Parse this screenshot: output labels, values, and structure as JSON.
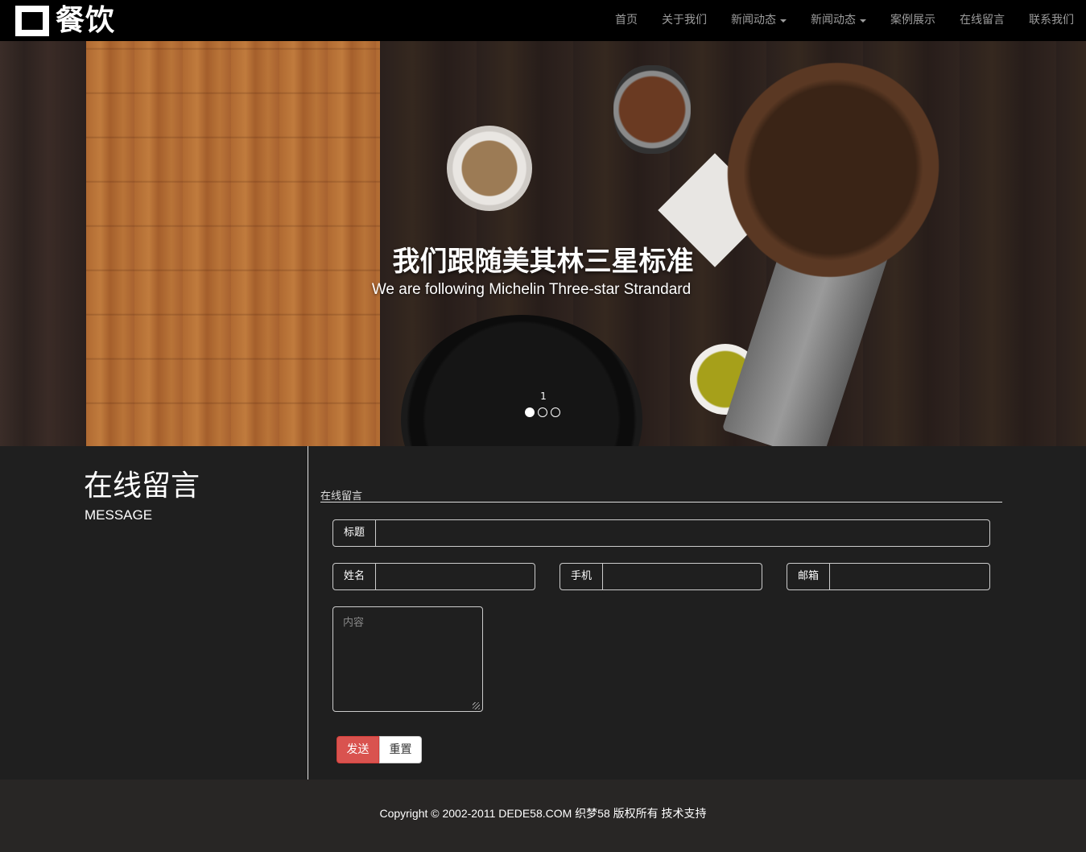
{
  "brand": {
    "logo_text": "餐饮"
  },
  "nav": {
    "items": [
      {
        "label": "首页",
        "dropdown": false
      },
      {
        "label": "关于我们",
        "dropdown": false
      },
      {
        "label": "新闻动态",
        "dropdown": true
      },
      {
        "label": "新闻动态",
        "dropdown": true
      },
      {
        "label": "案例展示",
        "dropdown": false
      },
      {
        "label": "在线留言",
        "dropdown": false
      },
      {
        "label": "联系我们",
        "dropdown": false
      }
    ]
  },
  "hero": {
    "title": "我们跟随美其林三星标准",
    "subtitle": "We are following Michelin Three-star Strandard",
    "slide_number": "1",
    "slide_count": 3,
    "active_slide": 1
  },
  "sidebar": {
    "title": "在线留言",
    "subtitle": "MESSAGE"
  },
  "form": {
    "section_heading": "在线留言",
    "title_label": "标题",
    "title_value": "",
    "name_label": "姓名",
    "name_value": "",
    "phone_label": "手机",
    "phone_value": "",
    "email_label": "邮箱",
    "email_value": "",
    "content_placeholder": "内容",
    "send_label": "发送",
    "reset_label": "重置"
  },
  "footer": {
    "copyright": "Copyright © 2002-2011 DEDE58.COM 织梦58 版权所有 技术支持"
  },
  "colors": {
    "navbar_bg": "#000000",
    "page_bg": "#1f1f1f",
    "footer_bg": "#282625",
    "send_button": "#d9534f",
    "nav_text": "#9d9d9d"
  }
}
